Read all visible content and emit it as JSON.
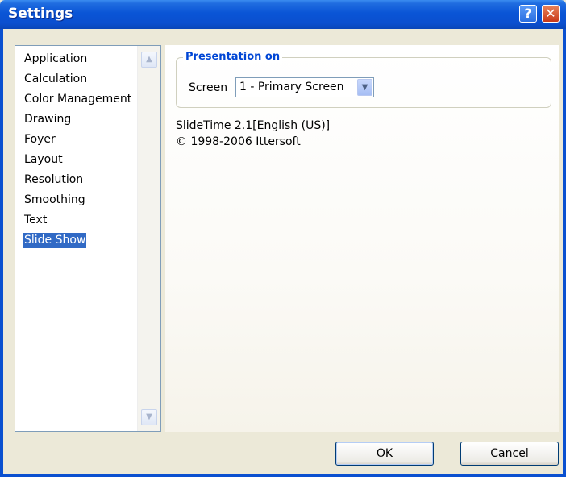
{
  "window": {
    "title": "Settings"
  },
  "title_buttons": {
    "help": "?",
    "close": "✕"
  },
  "sidebar": {
    "items": [
      {
        "label": "Application"
      },
      {
        "label": "Calculation"
      },
      {
        "label": "Color Management"
      },
      {
        "label": "Drawing"
      },
      {
        "label": "Foyer"
      },
      {
        "label": "Layout"
      },
      {
        "label": "Resolution"
      },
      {
        "label": "Smoothing"
      },
      {
        "label": "Text"
      },
      {
        "label": "Slide Show"
      }
    ],
    "selected": "Slide Show"
  },
  "presentation": {
    "group_title": "Presentation on",
    "screen_label": "Screen",
    "screen_value": "1 - Primary Screen"
  },
  "about": {
    "line1": "SlideTime 2.1[English (US)]",
    "line2": "© 1998-2006 Ittersoft"
  },
  "buttons": {
    "ok": "OK",
    "cancel": "Cancel"
  },
  "colors": {
    "titlebar": "#0a55d6",
    "selection": "#316ac5",
    "group_title": "#0046d5",
    "background": "#ECE9D8"
  }
}
